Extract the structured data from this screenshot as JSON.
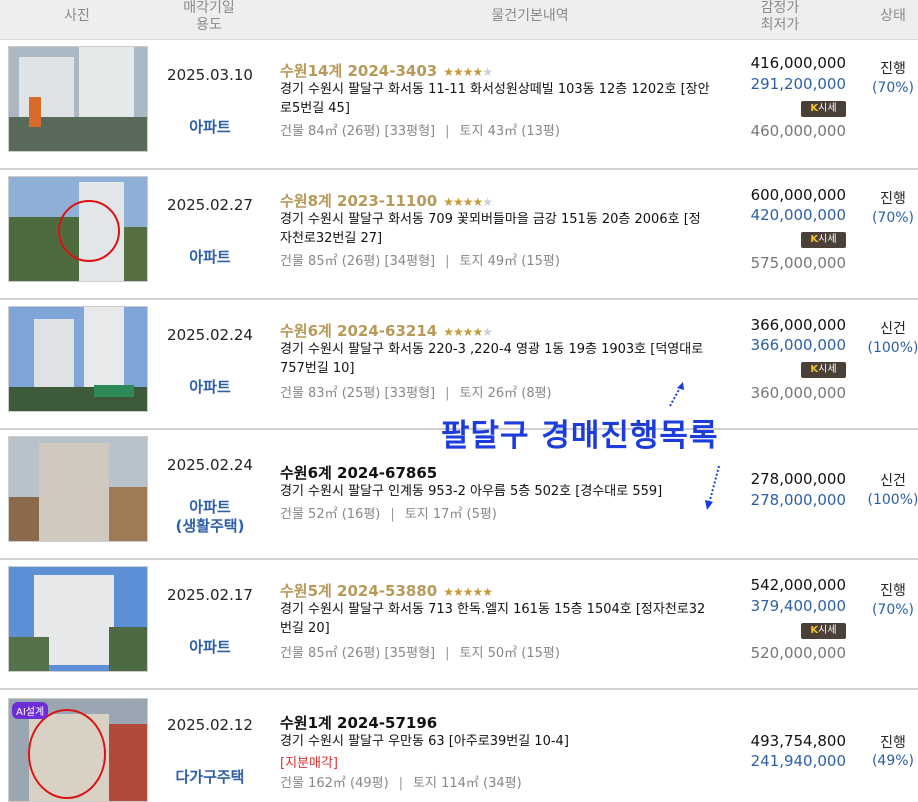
{
  "header": {
    "photo": "사진",
    "date_usage": "매각기일\n용도",
    "info": "물건기본내역",
    "price": "감정가\n최저가",
    "status": "상태"
  },
  "overlay": {
    "title": "팔달구 경매진행목록"
  },
  "market_badge": {
    "k": "K",
    "label": "시세"
  },
  "listings": [
    {
      "date": "2025.03.10",
      "usage": "아파트",
      "case_no": "수원14계 2024-3403",
      "stars": 4,
      "address": "경기 수원시 팔달구 화서동 11-11 화서성원상떼빌 103동 12층 1202호 [장안로5번길 45]",
      "building_area": "건물 84㎡ (26평) [33평형]",
      "land_area": "토지 43㎡ (13평)",
      "appraisal": "416,000,000",
      "minimum": "291,200,000",
      "market": "460,000,000",
      "status": "진행",
      "percent": "(70%)"
    },
    {
      "date": "2025.02.27",
      "usage": "아파트",
      "case_no": "수원8계 2023-11100",
      "stars": 4,
      "address": "경기 수원시 팔달구 화서동 709 꽃뫼버들마을 금강 151동 20층 2006호 [정자천로32번길 27]",
      "building_area": "건물 85㎡ (26평) [34평형]",
      "land_area": "토지 49㎡ (15평)",
      "appraisal": "600,000,000",
      "minimum": "420,000,000",
      "market": "575,000,000",
      "status": "진행",
      "percent": "(70%)"
    },
    {
      "date": "2025.02.24",
      "usage": "아파트",
      "case_no": "수원6계 2024-63214",
      "stars": 4,
      "address": "경기 수원시 팔달구 화서동 220-3 ,220-4 영광 1동 19층 1903호 [덕영대로757번길 10]",
      "building_area": "건물 83㎡ (25평) [33평형]",
      "land_area": "토지 26㎡ (8평)",
      "appraisal": "366,000,000",
      "minimum": "366,000,000",
      "market": "360,000,000",
      "status": "신건",
      "percent": "(100%)"
    },
    {
      "date": "2025.02.24",
      "usage": "아파트\n(생활주택)",
      "case_no": "수원6계 2024-67865",
      "stars": 0,
      "address": "경기 수원시 팔달구 인계동 953-2 아우름 5층 502호 [경수대로 559]",
      "building_area": "건물 52㎡ (16평)",
      "land_area": "토지 17㎡ (5평)",
      "appraisal": "278,000,000",
      "minimum": "278,000,000",
      "market": "",
      "status": "신건",
      "percent": "(100%)"
    },
    {
      "date": "2025.02.17",
      "usage": "아파트",
      "case_no": "수원5계 2024-53880",
      "stars": 5,
      "address": "경기 수원시 팔달구 화서동 713 한독.엘지 161동 15층 1504호 [정자천로32번길 20]",
      "building_area": "건물 85㎡ (26평) [35평형]",
      "land_area": "토지 50㎡ (15평)",
      "appraisal": "542,000,000",
      "minimum": "379,400,000",
      "market": "520,000,000",
      "status": "진행",
      "percent": "(70%)"
    },
    {
      "date": "2025.02.12",
      "usage": "다가구주택",
      "case_no": "수원1계 2024-57196",
      "stars": 0,
      "address": "경기 수원시 팔달구 우만동 63 [아주로39번길 10-4]",
      "note": "[지분매각]",
      "building_area": "건물 162㎡ (49평)",
      "land_area": "토지 114㎡ (34평)",
      "appraisal": "493,754,800",
      "minimum": "241,940,000",
      "market": "",
      "status": "진행",
      "percent": "(49%)",
      "photo_badge": "AI설계"
    }
  ],
  "colors": {
    "accent_blue": "#2c5fa8",
    "case_gold": "#b79a5a",
    "overlay_blue": "#1c3ddb"
  }
}
